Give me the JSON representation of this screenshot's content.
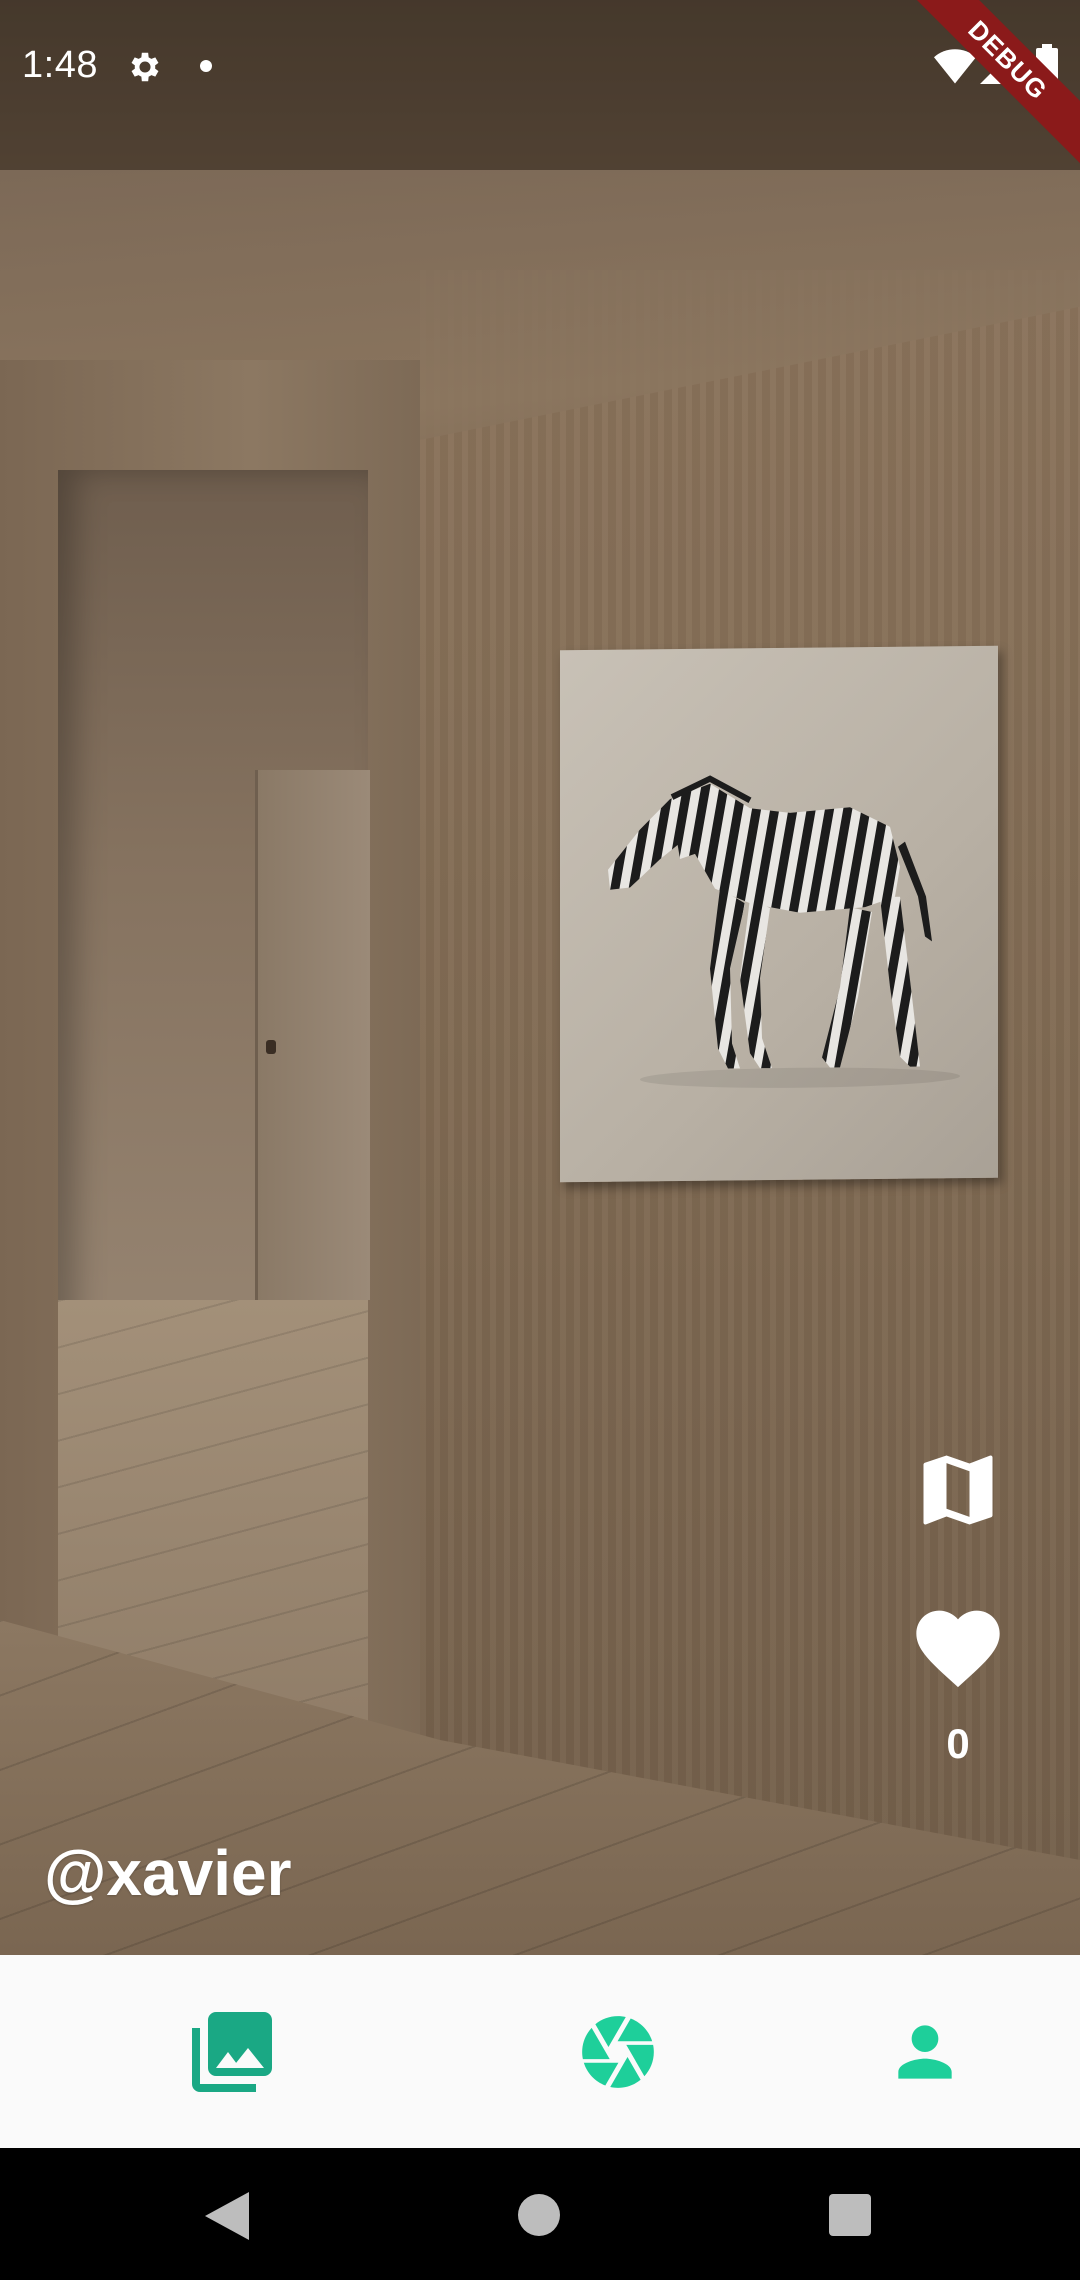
{
  "status_bar": {
    "time": "1:48",
    "icons": [
      "gear-icon",
      "notification-dot-icon",
      "wifi-icon",
      "signal-icon",
      "battery-icon"
    ]
  },
  "debug_banner": {
    "label": "DEBUG",
    "color": "#8b1a1a"
  },
  "post": {
    "username": "@xavier",
    "like_count": "0",
    "actions": [
      "map-icon",
      "heart-icon"
    ]
  },
  "bottom_nav": {
    "accent_color": "#1ecf9a",
    "items": [
      {
        "icon": "gallery-icon",
        "active": true
      },
      {
        "icon": "camera-aperture-icon",
        "active": false
      },
      {
        "icon": "profile-icon",
        "active": false
      }
    ]
  },
  "system_nav": {
    "buttons": [
      "back-icon",
      "home-icon",
      "recents-icon"
    ]
  }
}
